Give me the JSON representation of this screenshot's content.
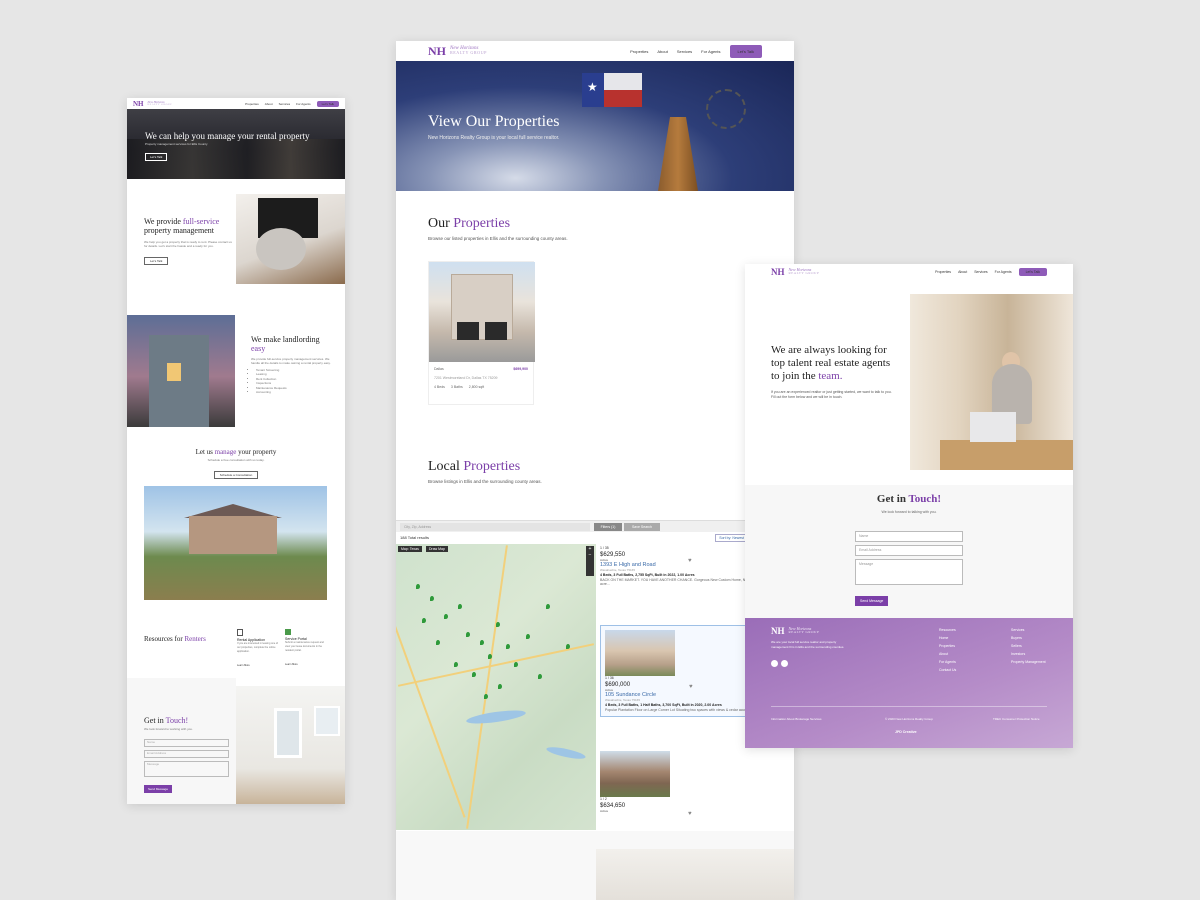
{
  "brand": {
    "mark": "NH",
    "script": "New Horizons",
    "tagline": "REALTY GROUP",
    "accent": "#7b3fa8",
    "cta_color": "#8e5bb8"
  },
  "nav": {
    "links": [
      "Properties",
      "About",
      "Services",
      "For Agents"
    ],
    "cta": "Let's Talk"
  },
  "panel1": {
    "hero_title": "We can help you manage your rental property",
    "hero_sub": "Property management services for Ellis County",
    "hero_btn": "Let's Talk",
    "s1_a": "We provide ",
    "s1_hl": "full-service",
    "s1_b": " property management",
    "s1_text": "We help you get a property that is ready to rent. Please contact us for details. Let's start the hassle and a ready for you.",
    "s1_btn": "Let's Talk",
    "s2_a": "We make landlording ",
    "s2_hl": "easy",
    "s2_text": "We provide full-service property management services. We handle all the details to make owning a rental property easy.",
    "s2_list": [
      "Tenant Screening",
      "Leasing",
      "Rent Collection",
      "Inspections",
      "Maintenance Requests",
      "Accounting"
    ],
    "s3_a": "Let us ",
    "s3_hl": "manage",
    "s3_b": " your property",
    "s3_sub": "Schedule a free consultation with us today.",
    "s3_btn": "Schedule a Consultation",
    "res_a": "Resources for ",
    "res_hl": "Renters",
    "res1_title": "Rental Application",
    "res1_text": "If you are interested in leasing one of our properties, complete the online application.",
    "res1_link": "Learn More",
    "res2_title": "Service Portal",
    "res2_text": "Submit a maintenance request and view your lease documents in the resident portal.",
    "res2_link": "Learn More",
    "contact_a": "Get in ",
    "contact_hl": "Touch!",
    "contact_sub": "We look forward to working with you.",
    "f_name": "Name",
    "f_email": "Email Address",
    "f_msg": "Message",
    "f_btn": "Send Message"
  },
  "panel2": {
    "hero_title": "View Our Properties",
    "hero_sub": "New Horizons Realty Group is your local full service realtor.",
    "s1_a": "Our ",
    "s1_hl": "Properties",
    "s1_sub": "Browse our listed properties in Ellis and the surrounding county areas.",
    "card_city": "Dallas",
    "card_price": "$699,900",
    "card_addr": "7201 Westmoreland Dr, Dallas TX 75209",
    "card_beds": "4 Beds",
    "card_baths": "3 Baths",
    "card_sqft": "2,800 sqft",
    "s2_a": "Local ",
    "s2_hl": "Properties",
    "s2_sub": "Browse listings in Ellis and the surrounding county areas.",
    "search_ph": "City, Zip, Address",
    "btn_filters": "Filters (1)",
    "btn_save": "Save Search",
    "results": "188 Total results",
    "sort": "Sort by: Newest",
    "map_tab": "Map: Texas",
    "map_tab2": "Draw Map",
    "listings": [
      {
        "count": "1 / 35",
        "price": "$629,550",
        "status": "Active",
        "addr": "1393 E High and Road",
        "city": "Waxahachie, Texas 75165",
        "beds": "4 Beds, 3 Full Baths, 2,755 SqFt, Built in 2022, 1.00 Acres",
        "text": "BACK ON THE MARKET. YOU HAVE ANOTHER CHANCE. Gorgeous New Custom Home, NO CITY TAXES. On 1.00 acre..."
      },
      {
        "count": "1 / 36",
        "price": "$690,000",
        "status": "Active",
        "addr": "105 Sundance Circle",
        "city": "Waxahachie, Texas 75165",
        "beds": "4 Beds, 3 Full Baths, 1 Half Baths, 3,700 SqFt, Built in 2020, 2.00 Acres",
        "text": "Popular Plantation Floor on Large Corner Lot Situating two spaces with views & cedar accents. Wood and..."
      },
      {
        "count": "1 / 2",
        "price": "$634,650",
        "status": "Active",
        "addr": "",
        "city": "",
        "beds": "",
        "text": ""
      }
    ]
  },
  "panel3": {
    "hero_a": "We are always looking for top talent real estate agents to join the ",
    "hero_hl": "team.",
    "hero_text": "If you are an experienced realtor or just getting started, we want to talk to you. Fill out the form below and we will be in touch.",
    "contact_a": "Get in ",
    "contact_hl": "Touch!",
    "contact_sub": "We look forward to talking with you.",
    "f_name": "Name",
    "f_email": "Email Address",
    "f_msg": "Message",
    "f_btn": "Send Message",
    "footer_text": "We are your local full service realtor and property management firm in Ellis and the surrounding counties.",
    "col1": [
      "Resources",
      "Home",
      "Properties",
      "About",
      "For Agents",
      "Contact Us"
    ],
    "col2": [
      "Services",
      "Buyers",
      "Sellers",
      "Investors",
      "Property Management"
    ],
    "fine1": "Information About Brokerage Services",
    "fine2": "© 2023 New Horizons Realty Group",
    "fine3": "TREC Consumer Protection Notice",
    "credit": "JPD Creative"
  }
}
